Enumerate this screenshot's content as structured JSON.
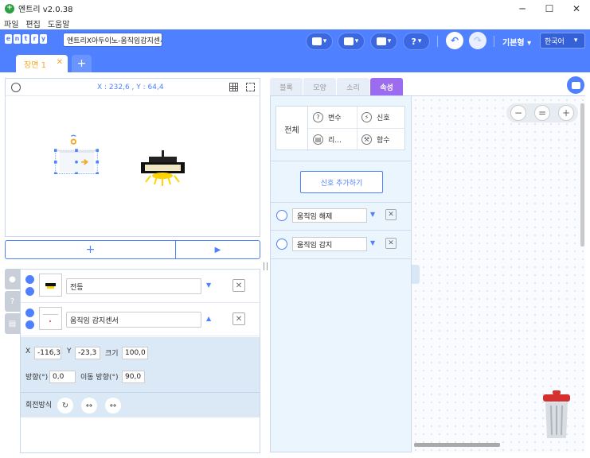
{
  "window": {
    "title": "엔트리 v2.0.38",
    "minimize": "─",
    "maximize": "☐",
    "close": "✕"
  },
  "menu": [
    "파일",
    "편집",
    "도움말"
  ],
  "toolbar": {
    "logo_letters": [
      "e",
      "n",
      "t",
      "r",
      "y"
    ],
    "project_name": "엔트리X아두이노-움직임감지센서",
    "mode_label": "기본형",
    "language": "한국어",
    "help_glyph": "?",
    "undo_glyph": "↶",
    "redo_glyph": "↷",
    "dropdown_glyph": "▾"
  },
  "scene": {
    "tab_label": "장면 1",
    "tab_close": "✕",
    "add_glyph": "+"
  },
  "stage": {
    "coordinates": "X : 232,6 , Y : 64,4",
    "add_glyph": "+",
    "run_glyph": "▶"
  },
  "side_tabs": [
    "●",
    "?",
    "▤"
  ],
  "objects": [
    {
      "name": "전등",
      "toggle": "▼",
      "delete": "✕"
    },
    {
      "name": "움직임 감지센서",
      "toggle": "▲",
      "delete": "✕"
    }
  ],
  "properties": {
    "x_label": "X",
    "x_value": "-116,3",
    "y_label": "Y",
    "y_value": "-23,3",
    "size_label": "크기",
    "size_value": "100,0",
    "direction_label": "방향(°)",
    "direction_value": "0,0",
    "move_direction_label": "이동 방향(°)",
    "move_direction_value": "90,0",
    "rotation_label": "회전방식",
    "rotation_glyphs": [
      "↻",
      "↔",
      "↔"
    ]
  },
  "block_tabs": [
    "블록",
    "모양",
    "소리",
    "속성"
  ],
  "categories": {
    "all_label": "전체",
    "items": [
      {
        "icon": "?",
        "label": "변수"
      },
      {
        "icon": "⚡",
        "label": "신호"
      },
      {
        "icon": "▤",
        "label": "리..."
      },
      {
        "icon": "⚒",
        "label": "함수"
      }
    ]
  },
  "signals": {
    "add_button": "신호 추가하기",
    "items": [
      {
        "name": "움직임 해제",
        "toggle": "▼",
        "delete": "✕"
      },
      {
        "name": "움직임 감지",
        "toggle": "▼",
        "delete": "✕"
      }
    ]
  },
  "workspace": {
    "zoom_out": "−",
    "zoom_reset": "=",
    "zoom_in": "+"
  },
  "colors": {
    "brand_blue": "#4f80ff",
    "active_tab_purple": "#9b6cf0",
    "scene_orange": "#f5a623"
  }
}
